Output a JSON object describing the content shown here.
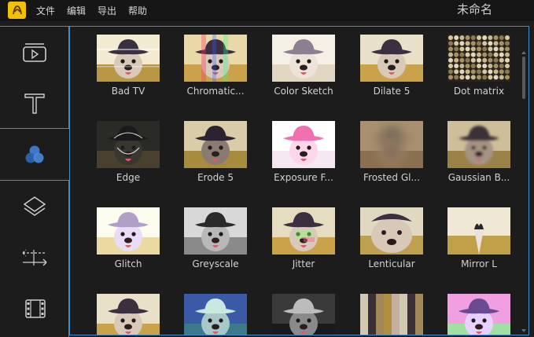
{
  "app": {
    "doc_title": "未命名"
  },
  "menu": {
    "items": [
      "文件",
      "编辑",
      "导出",
      "帮助"
    ]
  },
  "sidebar": {
    "items": [
      {
        "name": "media",
        "icon": "video-icon"
      },
      {
        "name": "text",
        "icon": "text-icon"
      },
      {
        "name": "filters",
        "icon": "filters-icon",
        "active": true
      },
      {
        "name": "overlays",
        "icon": "layers-icon"
      },
      {
        "name": "transitions",
        "icon": "transition-icon"
      },
      {
        "name": "elements",
        "icon": "film-icon"
      }
    ]
  },
  "filters": [
    {
      "label": "Bad TV",
      "fx": "badtv"
    },
    {
      "label": "Chromatic...",
      "fx": "chromatic"
    },
    {
      "label": "Color Sketch",
      "fx": "sketch"
    },
    {
      "label": "Dilate 5",
      "fx": "normal"
    },
    {
      "label": "Dot matrix",
      "fx": "dots"
    },
    {
      "label": "Edge",
      "fx": "edge"
    },
    {
      "label": "Erode 5",
      "fx": "erode"
    },
    {
      "label": "Exposure F...",
      "fx": "exposure"
    },
    {
      "label": "Frosted Gl...",
      "fx": "frosted"
    },
    {
      "label": "Gaussian B...",
      "fx": "gauss"
    },
    {
      "label": "Glitch",
      "fx": "glitch"
    },
    {
      "label": "Greyscale",
      "fx": "grey"
    },
    {
      "label": "Jitter",
      "fx": "jitter"
    },
    {
      "label": "Lenticular",
      "fx": "lens"
    },
    {
      "label": "Mirror L",
      "fx": "mirror"
    },
    {
      "label": "",
      "fx": "normal"
    },
    {
      "label": "",
      "fx": "blue"
    },
    {
      "label": "",
      "fx": "dark"
    },
    {
      "label": "",
      "fx": "pixel"
    },
    {
      "label": "",
      "fx": "rainbow"
    }
  ],
  "colors": {
    "accent": "#3f8fcf",
    "logo": "#f2c200"
  }
}
